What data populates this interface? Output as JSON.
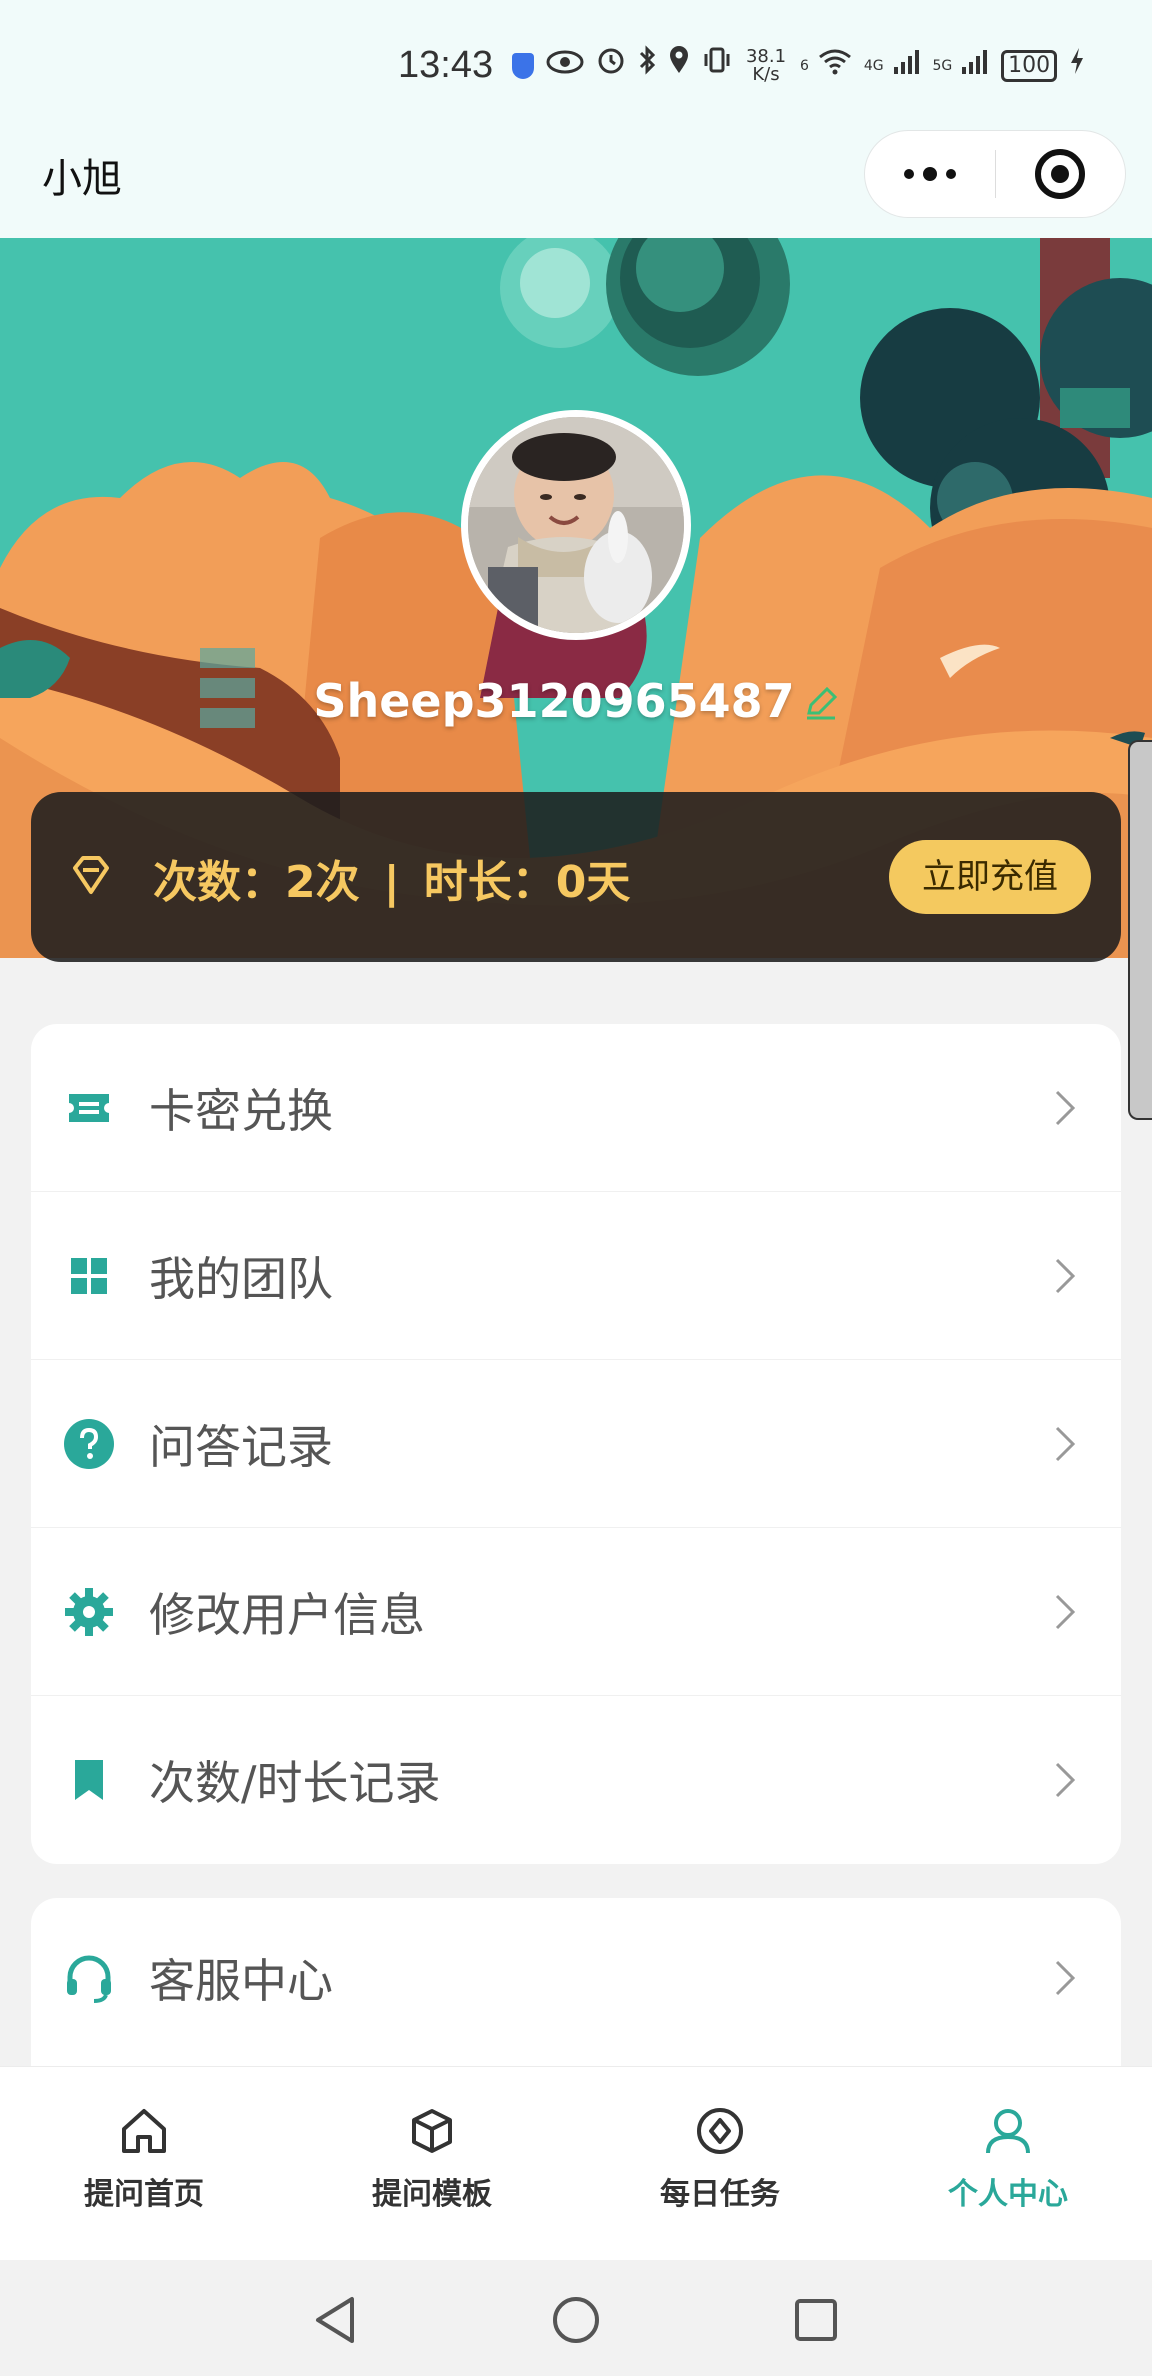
{
  "status_bar": {
    "time": "13:43",
    "net_speed_value": "38.1",
    "net_speed_unit": "K/s",
    "wifi_tag": "6",
    "sim1_tag": "4G",
    "sim2_tag": "5G",
    "battery": "100"
  },
  "nav": {
    "title": "小旭"
  },
  "profile": {
    "username": "Sheep3120965487"
  },
  "usage": {
    "times_text": "次数：2次",
    "separator": "|",
    "duration_text": "时长：0天",
    "recharge_label": "立即充值"
  },
  "menu_primary": [
    {
      "label": "卡密兑换",
      "icon": "ticket-icon"
    },
    {
      "label": "我的团队",
      "icon": "grid-icon"
    },
    {
      "label": "问答记录",
      "icon": "question-icon"
    },
    {
      "label": "修改用户信息",
      "icon": "gear-icon"
    },
    {
      "label": "次数/时长记录",
      "icon": "bookmark-icon"
    }
  ],
  "menu_secondary": [
    {
      "label": "客服中心",
      "icon": "headset-icon"
    }
  ],
  "tabs": [
    {
      "label": "提问首页",
      "icon": "home-icon",
      "active": false
    },
    {
      "label": "提问模板",
      "icon": "box-icon",
      "active": false
    },
    {
      "label": "每日任务",
      "icon": "compass-icon",
      "active": false
    },
    {
      "label": "个人中心",
      "icon": "user-icon",
      "active": true
    }
  ],
  "colors": {
    "accent": "#2aa89a",
    "gold": "#f6c861",
    "teal_sky": "#45c2ad",
    "orange_hill": "#f29e58"
  }
}
